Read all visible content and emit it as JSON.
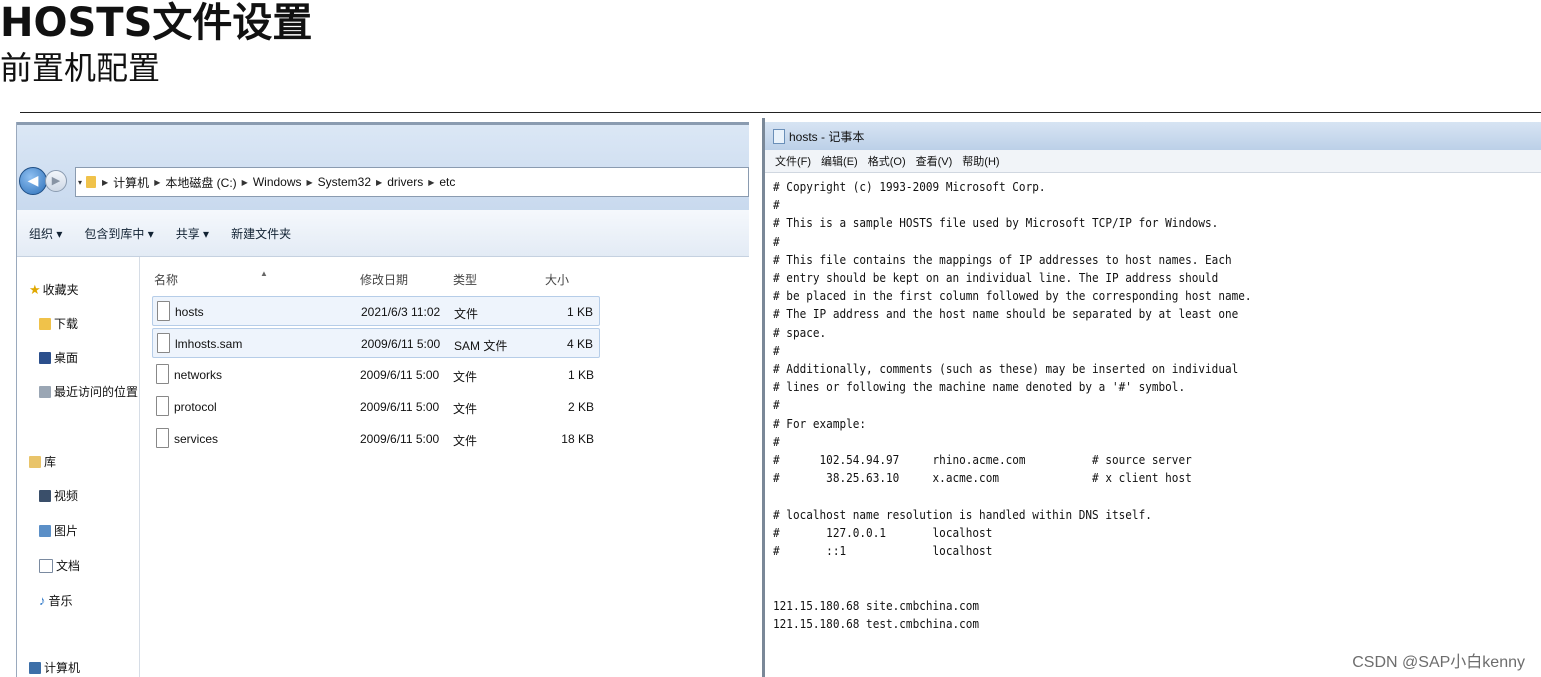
{
  "slide": {
    "title": "HOSTS文件设置",
    "subtitle": "前置机配置",
    "watermark": "CSDN @SAP小白kenny"
  },
  "explorer": {
    "breadcrumbs": [
      "计算机",
      "本地磁盘 (C:)",
      "Windows",
      "System32",
      "drivers",
      "etc"
    ],
    "commands": [
      "组织 ▾",
      "包含到库中 ▾",
      "共享 ▾",
      "新建文件夹"
    ],
    "sidebar": [
      {
        "label": "收藏夹",
        "icon": "star-icon"
      },
      {
        "label": "下载",
        "icon": "download-folder-icon"
      },
      {
        "label": "桌面",
        "icon": "desktop-icon"
      },
      {
        "label": "最近访问的位置",
        "icon": "recent-places-icon"
      },
      {
        "label": "库",
        "icon": "library-icon"
      },
      {
        "label": "视频",
        "icon": "video-icon"
      },
      {
        "label": "图片",
        "icon": "picture-icon"
      },
      {
        "label": "文档",
        "icon": "document-icon"
      },
      {
        "label": "音乐",
        "icon": "music-icon"
      },
      {
        "label": "计算机",
        "icon": "computer-icon"
      }
    ],
    "columns": {
      "name": "名称",
      "modified": "修改日期",
      "type": "类型",
      "size": "大小"
    },
    "files": [
      {
        "name": "hosts",
        "modified": "2021/6/3 11:02",
        "type": "文件",
        "size": "1 KB"
      },
      {
        "name": "lmhosts.sam",
        "modified": "2009/6/11 5:00",
        "type": "SAM 文件",
        "size": "4 KB"
      },
      {
        "name": "networks",
        "modified": "2009/6/11 5:00",
        "type": "文件",
        "size": "1 KB"
      },
      {
        "name": "protocol",
        "modified": "2009/6/11 5:00",
        "type": "文件",
        "size": "2 KB"
      },
      {
        "name": "services",
        "modified": "2009/6/11 5:00",
        "type": "文件",
        "size": "18 KB"
      }
    ]
  },
  "notepad": {
    "title": "hosts - 记事本",
    "menu": [
      "文件(F)",
      "编辑(E)",
      "格式(O)",
      "查看(V)",
      "帮助(H)"
    ],
    "content": "# Copyright (c) 1993-2009 Microsoft Corp.\n#\n# This is a sample HOSTS file used by Microsoft TCP/IP for Windows.\n#\n# This file contains the mappings of IP addresses to host names. Each\n# entry should be kept on an individual line. The IP address should\n# be placed in the first column followed by the corresponding host name.\n# The IP address and the host name should be separated by at least one\n# space.\n#\n# Additionally, comments (such as these) may be inserted on individual\n# lines or following the machine name denoted by a '#' symbol.\n#\n# For example:\n#\n#      102.54.94.97     rhino.acme.com          # source server\n#       38.25.63.10     x.acme.com              # x client host\n\n# localhost name resolution is handled within DNS itself.\n#\t127.0.0.1       localhost\n#\t::1             localhost\n\n\n121.15.180.68 site.cmbchina.com\n121.15.180.68 test.cmbchina.com"
  }
}
